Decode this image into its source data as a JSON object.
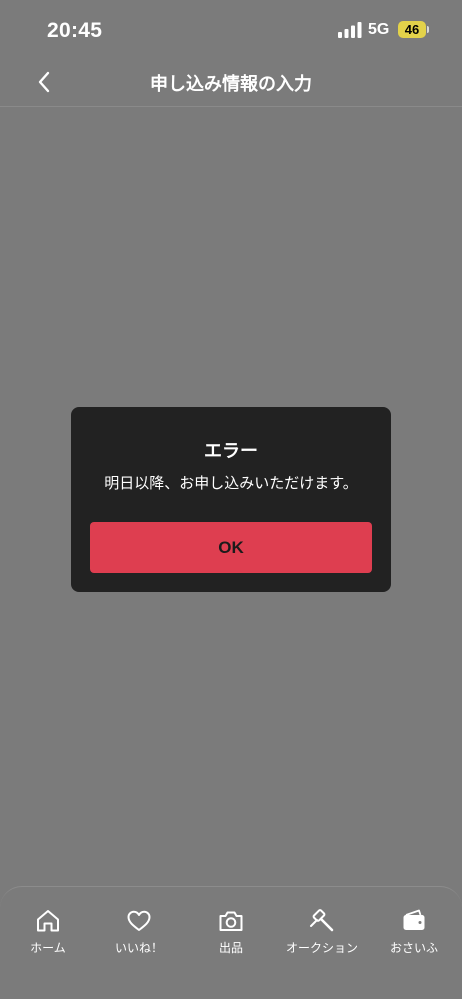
{
  "status_bar": {
    "time": "20:45",
    "network": "5G",
    "battery": "46",
    "battery_color": "#e3d24a"
  },
  "header": {
    "title": "申し込み情報の入力",
    "back_icon": "chevron-left-icon"
  },
  "dialog": {
    "title": "エラー",
    "message": "明日以降、お申し込みいただけます。",
    "ok_label": "OK",
    "ok_color": "#de3e50"
  },
  "tab_bar": {
    "items": [
      {
        "label": "ホーム",
        "icon": "home-icon"
      },
      {
        "label": "いいね！",
        "icon": "heart-icon"
      },
      {
        "label": "出品",
        "icon": "camera-icon"
      },
      {
        "label": "オークション",
        "icon": "gavel-icon"
      },
      {
        "label": "おさいふ",
        "icon": "wallet-icon"
      }
    ]
  }
}
